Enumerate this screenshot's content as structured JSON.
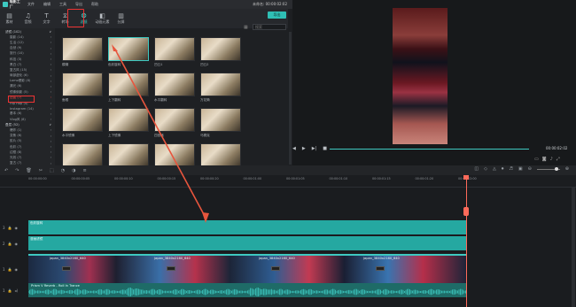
{
  "app": {
    "name": "喵影工厂",
    "project_title": "未命名: 00:00:02:02"
  },
  "menu": [
    "文件",
    "编辑",
    "工具",
    "导出",
    "帮助"
  ],
  "toolbar": {
    "tools": [
      {
        "label": "素材",
        "icon": "media-icon"
      },
      {
        "label": "音频",
        "icon": "music-icon"
      },
      {
        "label": "文字",
        "icon": "text-icon"
      },
      {
        "label": "转场",
        "icon": "transition-icon"
      },
      {
        "label": "滤镜",
        "icon": "filter-icon",
        "active": true
      },
      {
        "label": "动画元素",
        "icon": "elements-icon"
      },
      {
        "label": "分屏",
        "icon": "split-icon"
      }
    ],
    "export_label": "导出"
  },
  "sidebar": {
    "items": [
      {
        "label": "滤镜 (102)",
        "top": true
      },
      {
        "label": "摄影 (14)"
      },
      {
        "label": "生活 (12)"
      },
      {
        "label": "自然 (9)"
      },
      {
        "label": "旅行 (10)"
      },
      {
        "label": "科技 (3)"
      },
      {
        "label": "黑白 (7)"
      },
      {
        "label": "复古风 (15)"
      },
      {
        "label": "局部虚化 (6)"
      },
      {
        "label": "Lomo晕影 (8)"
      },
      {
        "label": "漏光 (6)"
      },
      {
        "label": "镜像倒影 (5)"
      },
      {
        "label": "扭曲 (7)",
        "selected": true
      },
      {
        "label": "Hip Hop (4)"
      },
      {
        "label": "Instagram (14)"
      },
      {
        "label": "基本 (6)"
      },
      {
        "label": "Vlog风 (8)"
      },
      {
        "label": "叠层 (52)",
        "top": true
      },
      {
        "label": "爆炸 (1)"
      },
      {
        "label": "变焦 (6)"
      },
      {
        "label": "胶片 (5)"
      },
      {
        "label": "色彩 (7)"
      },
      {
        "label": "边框 (8)"
      },
      {
        "label": "光效 (7)"
      },
      {
        "label": "复古 (7)"
      }
    ]
  },
  "gallery": {
    "search_placeholder": "搜索",
    "rows": [
      [
        "模糊",
        "色彩旋转",
        "凹凸1",
        "凹凸2"
      ],
      [
        "鱼眼",
        "上下翻转",
        "水平翻转",
        "万花筒"
      ],
      [
        "水平镜像",
        "上下镜像",
        "四宫格",
        "马赛克"
      ],
      [
        "",
        "",
        "",
        ""
      ]
    ]
  },
  "preview": {
    "timecode": "00:00:02:02",
    "playback_icons": [
      "prev-frame-icon",
      "play-icon",
      "next-frame-icon",
      "stop-icon"
    ]
  },
  "timeline": {
    "ruler_ticks": [
      "00:00:00:00",
      "00:00:00:05",
      "00:00:00:10",
      "00:00:00:15",
      "00:00:00:20",
      "00:00:01:00",
      "00:00:01:05",
      "00:00:01:10",
      "00:00:01:15",
      "00:00:01:20",
      "00:00:02:00"
    ],
    "tracks": [
      {
        "head": "3",
        "clip": "色彩旋转"
      },
      {
        "head": "2",
        "clip": "漫画滤镜"
      },
      {
        "head": "1",
        "clip": ""
      },
      {
        "head": "1",
        "clip": "Prism V Reverb - Roll In Trance"
      }
    ],
    "video_labels": [
      "japan_3840x2160_640",
      "japan_3840x2160_640",
      "japan_3840x2160_640",
      "japan_3840x2160_640"
    ]
  }
}
